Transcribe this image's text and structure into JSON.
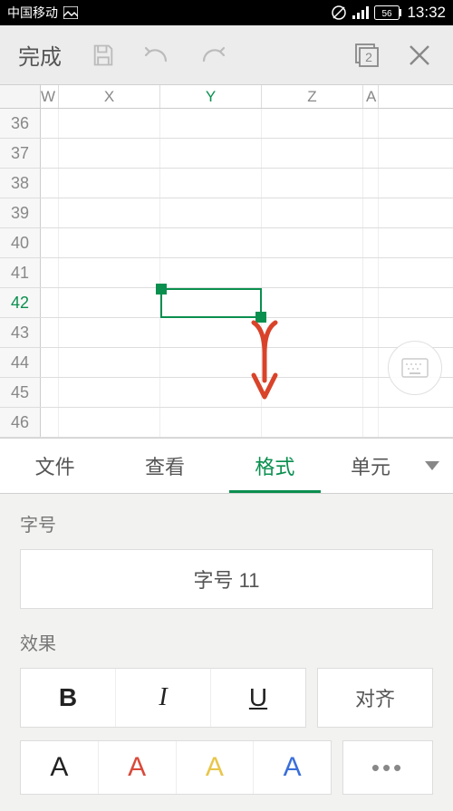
{
  "status": {
    "carrier": "中国移动",
    "battery": "56",
    "time": "13:32"
  },
  "toolbar": {
    "done": "完成",
    "sheet_badge": "2"
  },
  "sheet": {
    "col_partial_left": "W",
    "cols": [
      "X",
      "Y",
      "Z"
    ],
    "col_partial_right": "A",
    "selected_col": "Y",
    "rows": [
      36,
      37,
      38,
      39,
      40,
      41,
      42,
      43,
      44,
      45,
      46
    ],
    "selected_row": 42,
    "selected_cell": "Y42"
  },
  "tabs": {
    "items": [
      "文件",
      "查看",
      "格式",
      "单元"
    ],
    "truncated_last": "单元",
    "displayed_last": "单元",
    "active": 2
  },
  "panel": {
    "size_label": "字号",
    "size_value": "字号  11",
    "effects_label": "效果",
    "effects": {
      "bold": "B",
      "italic": "I",
      "underline": "U"
    },
    "align": "对齐",
    "colors": [
      "#222222",
      "#d94a3a",
      "#e8c64a",
      "#3a6fd9"
    ],
    "color_glyph": "A",
    "more": "•••"
  }
}
